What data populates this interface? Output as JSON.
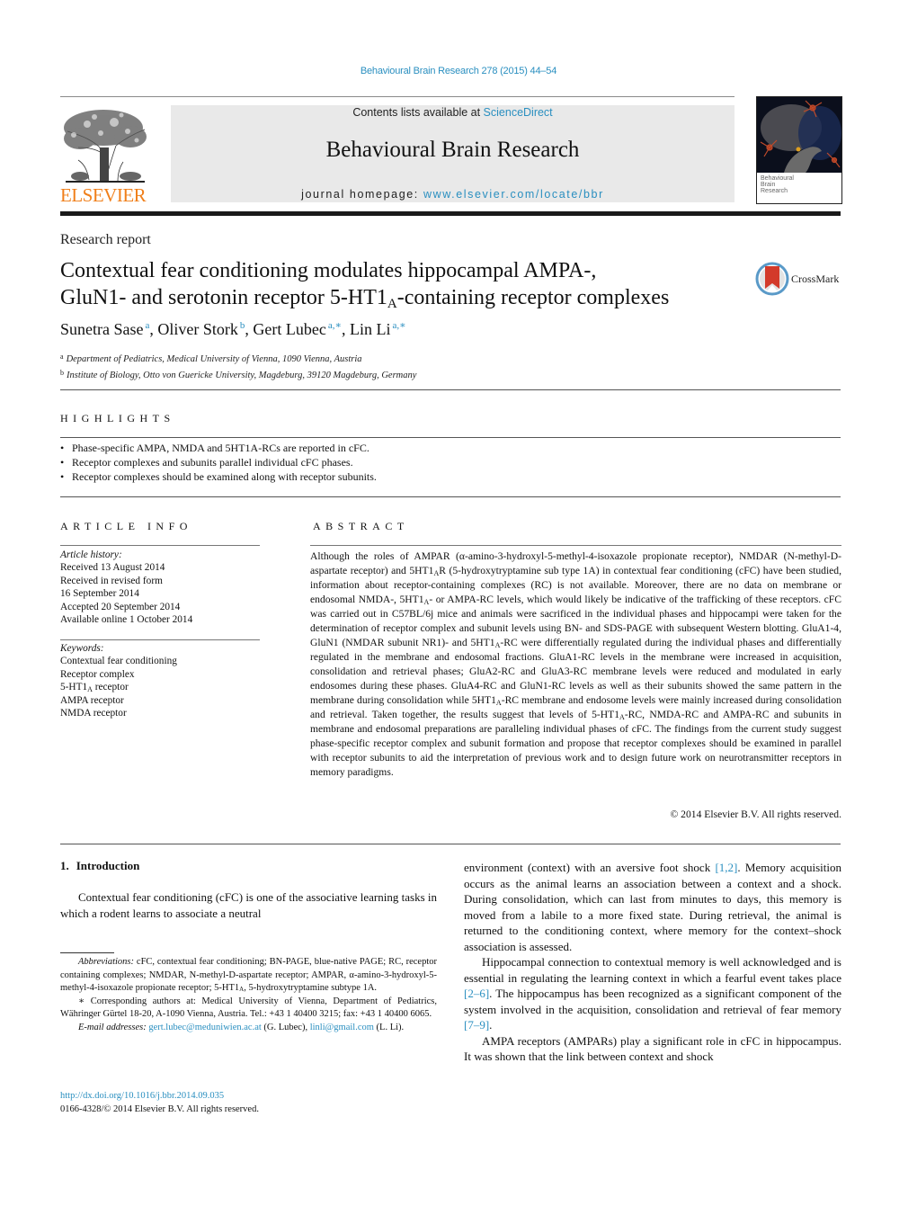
{
  "running_header": "Behavioural Brain Research 278 (2015) 44–54",
  "masthead": {
    "contents_prefix": "Contents lists available at ",
    "contents_link": "ScienceDirect",
    "journal_title": "Behavioural Brain Research",
    "homepage_prefix": "journal homepage: ",
    "homepage_link": "www.elsevier.com/locate/bbr",
    "publisher_logo_text": "ELSEVIER",
    "cover_caption": [
      "Behavioural",
      "Brain",
      "Research"
    ],
    "colors": {
      "link": "#2a8fc0",
      "elsevier_orange": "#f07f1a",
      "masthead_bg": "#e9e9e9"
    }
  },
  "article": {
    "type": "Research report",
    "title_line1": "Contextual fear conditioning modulates hippocampal AMPA-,",
    "title_line2_pre": "GluN1- and serotonin receptor 5-HT1",
    "title_line2_sub": "A",
    "title_line2_post": "-containing receptor complexes",
    "crossmark_label": "CrossMark",
    "authors": [
      {
        "name": "Sunetra Sase",
        "affil": "a"
      },
      {
        "name": "Oliver Stork",
        "affil": "b"
      },
      {
        "name": "Gert Lubec",
        "affil": "a,∗"
      },
      {
        "name": "Lin Li",
        "affil": "a,∗"
      }
    ],
    "affiliations": [
      {
        "key": "a",
        "text": "Department of Pediatrics, Medical University of Vienna, 1090 Vienna, Austria"
      },
      {
        "key": "b",
        "text": "Institute of Biology, Otto von Guericke University, Magdeburg, 39120 Magdeburg, Germany"
      }
    ]
  },
  "highlights": {
    "label": "HIGHLIGHTS",
    "items": [
      "Phase-specific AMPA, NMDA and 5HT1A-RCs are reported in cFC.",
      "Receptor complexes and subunits parallel individual cFC phases.",
      "Receptor complexes should be examined along with receptor subunits."
    ]
  },
  "article_info": {
    "label": "ARTICLE INFO",
    "history_label": "Article history:",
    "history": [
      "Received 13 August 2014",
      "Received in revised form",
      "16 September 2014",
      "Accepted 20 September 2014",
      "Available online 1 October 2014"
    ],
    "keywords_label": "Keywords:",
    "keywords": [
      "Contextual fear conditioning",
      "Receptor complex",
      "5-HT1A receptor",
      "AMPA receptor",
      "NMDA receptor"
    ],
    "keyword_5ht_pre": "5-HT1",
    "keyword_5ht_sub": "A",
    "keyword_5ht_post": " receptor"
  },
  "abstract": {
    "label": "ABSTRACT",
    "segments": [
      "Although the roles of AMPAR (α-amino-3-hydroxyl-5-methyl-4-isoxazole propionate receptor), NMDAR (N-methyl-D-aspartate receptor) and 5HT1",
      "A",
      "R (5-hydroxytryptamine sub type 1A) in contextual fear conditioning (cFC) have been studied, information about receptor-containing complexes (RC) is not available. Moreover, there are no data on membrane or endosomal NMDA-, 5HT1",
      "A",
      "- or AMPA-RC levels, which would likely be indicative of the trafficking of these receptors. cFC was carried out in C57BL/6j mice and animals were sacrificed in the individual phases and hippocampi were taken for the determination of receptor complex and subunit levels using BN- and SDS-PAGE with subsequent Western blotting. GluA1-4, GluN1 (NMDAR subunit NR1)- and 5HT1",
      "A",
      "-RC were differentially regulated during the individual phases and differentially regulated in the membrane and endosomal fractions. GluA1-RC levels in the membrane were increased in acquisition, consolidation and retrieval phases; GluA2-RC and GluA3-RC membrane levels were reduced and modulated in early endosomes during these phases. GluA4-RC and GluN1-RC levels as well as their subunits showed the same pattern in the membrane during consolidation while 5HT1",
      "A",
      "-RC membrane and endosome levels were mainly increased during consolidation and retrieval. Taken together, the results suggest that levels of 5-HT1",
      "A",
      "-RC, NMDA-RC and AMPA-RC and subunits in membrane and endosomal preparations are paralleling individual phases of cFC. The findings from the current study suggest phase-specific receptor complex and subunit formation and propose that receptor complexes should be examined in parallel with receptor subunits to aid the interpretation of previous work and to design future work on neurotransmitter receptors in memory paradigms."
    ],
    "copyright": "© 2014 Elsevier B.V. All rights reserved."
  },
  "introduction": {
    "number": "1.",
    "heading": "Introduction",
    "left_para": "Contextual fear conditioning (cFC) is one of the associative learning tasks in which a rodent learns to associate a neutral",
    "right_p1_a": "environment (context) with an aversive foot shock ",
    "right_p1_ref": "[1,2]",
    "right_p1_b": ". Memory acquisition occurs as the animal learns an association between a context and a shock. During consolidation, which can last from minutes to days, this memory is moved from a labile to a more fixed state. During retrieval, the animal is returned to the conditioning context, where memory for the context–shock association is assessed.",
    "right_p2_a": "Hippocampal connection to contextual memory is well acknowledged and is essential in regulating the learning context in which a fearful event takes place ",
    "right_p2_ref1": "[2–6]",
    "right_p2_b": ". The hippocampus has been recognized as a significant component of the system involved in the acquisition, consolidation and retrieval of fear memory ",
    "right_p2_ref2": "[7–9]",
    "right_p2_c": ".",
    "right_p3": "AMPA receptors (AMPARs) play a significant role in cFC in hippocampus. It was shown that the link between context and shock"
  },
  "footnotes": {
    "abbrev_label": "Abbreviations:",
    "abbrev_text_a": " cFC, contextual fear conditioning; BN-PAGE, blue-native PAGE; RC, receptor containing complexes; NMDAR, N-methyl-D-aspartate receptor; AMPAR, α-amino-3-hydroxyl-5-methyl-4-isoxazole propionate receptor; 5-HT1",
    "abbrev_sub": "A",
    "abbrev_text_b": ", 5-hydroxytryptamine subtype 1A.",
    "corresponding": "∗ Corresponding authors at: Medical University of Vienna, Department of Pediatrics, Währinger Gürtel 18-20, A-1090 Vienna, Austria. Tel.: +43 1 40400 3215; fax: +43 1 40400 6065.",
    "email_label": "E-mail addresses:",
    "email1": "gert.lubec@meduniwien.ac.at",
    "email1_who": " (G. Lubec), ",
    "email2": "linli@gmail.com",
    "email2_who": " (L. Li)."
  },
  "doi": {
    "link": "http://dx.doi.org/10.1016/j.bbr.2014.09.035",
    "issn_line": "0166-4328/© 2014 Elsevier B.V. All rights reserved."
  }
}
